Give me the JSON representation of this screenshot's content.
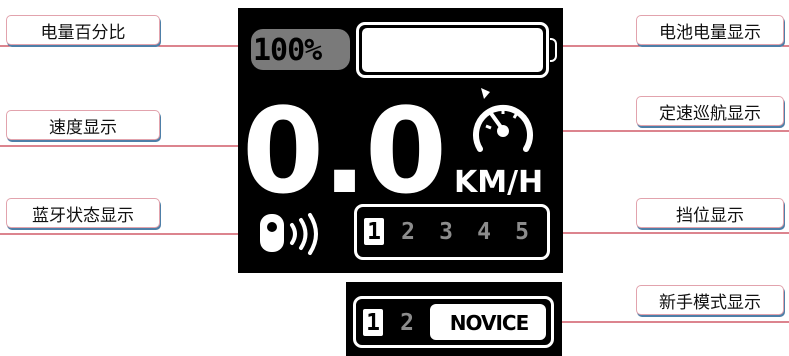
{
  "labels": {
    "battery_percent": "电量百分比",
    "battery_level": "电池电量显示",
    "speed": "速度显示",
    "cruise": "定速巡航显示",
    "bluetooth": "蓝牙状态显示",
    "gear": "挡位显示",
    "novice_mode": "新手模式显示"
  },
  "display": {
    "battery_percent": "100%",
    "speed": "0.0",
    "speed_unit": "KM/H",
    "gears": [
      "1",
      "2",
      "3",
      "4",
      "5"
    ],
    "active_gear": "1",
    "novice_gears": [
      "1",
      "2"
    ],
    "novice_active_gear": "1",
    "novice_label": "NOVICE"
  },
  "colors": {
    "leader_line": "#c63a4b",
    "callout_border": "#e2a3ad",
    "callout_shadow": "#4e7fa8",
    "screen_bg": "#000000",
    "inactive_gear": "#8c8c8c"
  }
}
